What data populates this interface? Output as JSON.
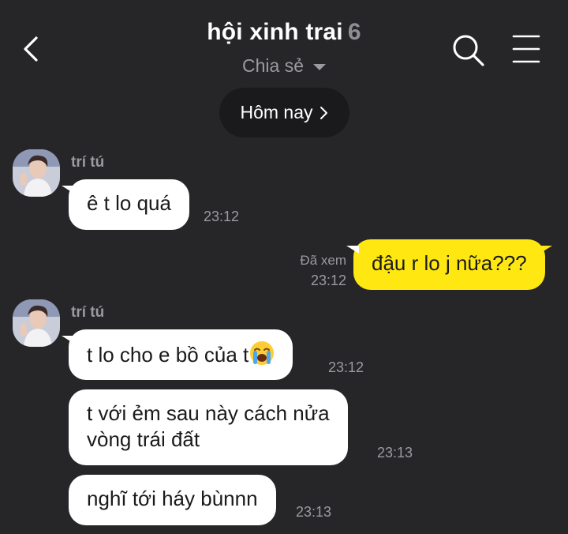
{
  "header": {
    "title": "hội xinh trai",
    "member_count": "6",
    "share_label": "Chia sẻ"
  },
  "date_divider": "Hôm nay",
  "messages": [
    {
      "sender": "trí tú",
      "text": "ê t lo quá",
      "time": "23:12"
    },
    {
      "text": "đậu r lo j nữa???",
      "time": "23:12",
      "read_label": "Đã xem"
    },
    {
      "sender": "trí tú",
      "text": "t lo cho e bồ của t",
      "emoji": "loudly-crying-face-icon",
      "time": "23:12"
    },
    {
      "text_line1": "t với ẻm sau này cách nửa",
      "text_line2": "vòng trái đất",
      "time": "23:13"
    },
    {
      "text": "nghĩ tới háy bùnnn",
      "time": "23:13"
    }
  ],
  "colors": {
    "background": "#262629",
    "my_bubble": "#ffe812",
    "their_bubble": "#ffffff",
    "secondary_text": "#9a9aa0"
  }
}
